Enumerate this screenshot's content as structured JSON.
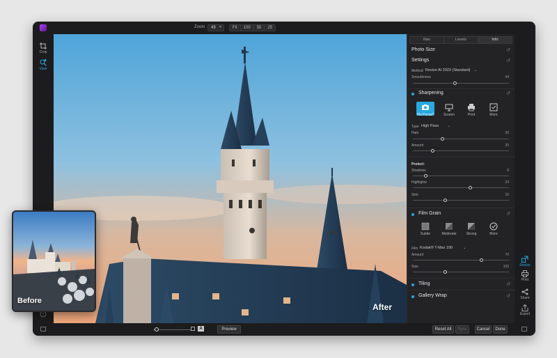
{
  "topbar": {
    "zoom_label": "Zoom",
    "zoom_value": "49",
    "zoom_presets": [
      "Fit",
      "100",
      "50",
      "25"
    ]
  },
  "left_tools": [
    {
      "label": "Crop",
      "icon": "crop-icon"
    },
    {
      "label": "View",
      "icon": "view-icon"
    }
  ],
  "canvas": {
    "after_label": "After"
  },
  "before_card": {
    "label": "Before"
  },
  "panel": {
    "tabs": [
      "Nav",
      "Levels",
      "Info"
    ],
    "photo_size": "Photo Size",
    "settings": "Settings",
    "method_label": "Method",
    "method_value": "Resize AI 2023 (Standard)",
    "smoothness_label": "Smoothness",
    "smoothness_value": "44",
    "sharpening": {
      "title": "Sharpening",
      "options": [
        "Fix Focus*",
        "Screen",
        "Print",
        "More"
      ],
      "type_label": "Type",
      "type_value": "High Pass",
      "halo_label": "Halo",
      "halo_value": "30",
      "amount_label": "Amount",
      "amount_value": "20",
      "protect_label": "Protect:",
      "shadows_label": "Shadows",
      "shadows_value": "8",
      "highlights_label": "Highlights",
      "highlights_value": "24",
      "skin_label": "Skin",
      "skin_value": "15"
    },
    "film_grain": {
      "title": "Film Grain",
      "options": [
        "Subtle",
        "Moderate",
        "Strong",
        "More"
      ],
      "film_label": "Film",
      "film_value": "Kodak® T-Max 100",
      "amount_label": "Amount",
      "amount_value": "70",
      "size_label": "Size",
      "size_value": "100"
    },
    "tiling": "Tiling",
    "gallery_wrap": "Gallery Wrap"
  },
  "right_tools": [
    {
      "label": "Resize",
      "icon": "resize-icon"
    },
    {
      "label": "Print",
      "icon": "print-icon"
    },
    {
      "label": "Share",
      "icon": "share-icon"
    },
    {
      "label": "Export",
      "icon": "export-icon"
    }
  ],
  "bottombar": {
    "preview_label": "Preview",
    "a_badge": "A",
    "reset_all_label": "Reset All",
    "sync_label": "Sync",
    "cancel_label": "Cancel",
    "done_label": "Done"
  },
  "colors": {
    "accent": "#2aa8e0",
    "app_bg": "#1c1c1e",
    "panel_bg": "#232325",
    "page_bg": "#e7e7e7"
  }
}
